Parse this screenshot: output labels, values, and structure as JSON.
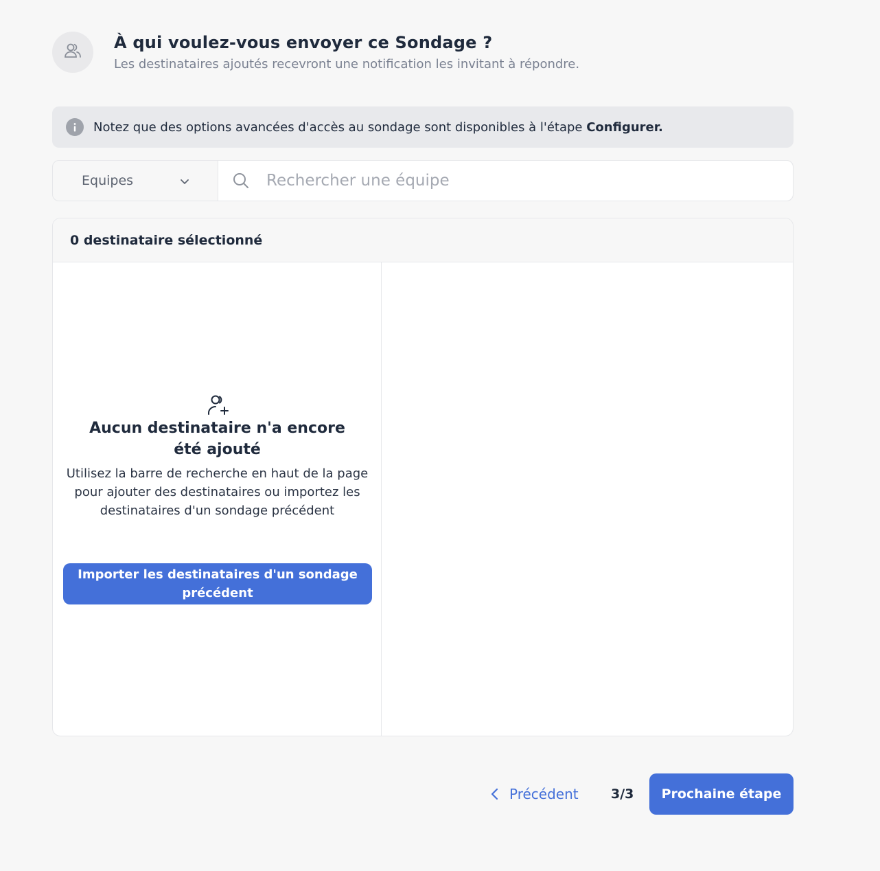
{
  "header": {
    "icon": "users-icon",
    "title": "À qui voulez-vous envoyer ce Sondage ?",
    "subtitle": "Les destinataires ajoutés recevront une notification les invitant à répondre."
  },
  "info_banner": {
    "icon": "info-icon",
    "text": "Notez que des options avancées d'accès au sondage sont disponibles à l'étape ",
    "emphasis": "Configurer."
  },
  "search": {
    "team_select_value": "Equipes",
    "placeholder": "Rechercher une équipe",
    "value": ""
  },
  "recipients": {
    "count_label": "0 destinataire sélectionné",
    "empty_icon": "user-add-icon",
    "empty_title": "Aucun destinataire n'a encore été ajouté",
    "empty_text": "Utilisez la barre de recherche en haut de la page pour ajouter des destinataires ou importez les destinataires d'un sondage précédent",
    "import_button": "Importer les destinataires d'un sondage précédent"
  },
  "footer": {
    "prev_label": "Précédent",
    "step": "3/3",
    "next_label": "Prochaine étape"
  },
  "colors": {
    "accent": "#4470d9",
    "background": "#f7f7f7",
    "text": "#1f2a3c"
  }
}
